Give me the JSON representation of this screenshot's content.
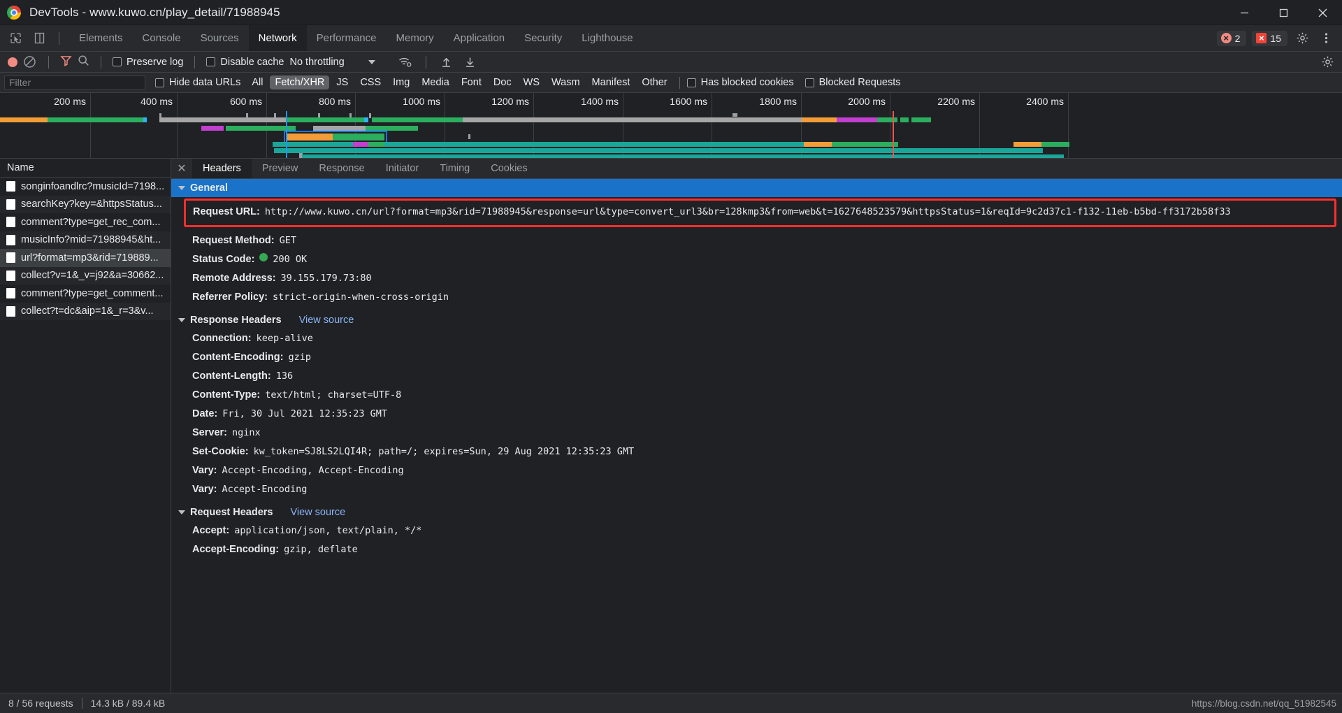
{
  "window": {
    "title": "DevTools - www.kuwo.cn/play_detail/71988945",
    "logo_icon": "chrome-logo",
    "minimize_icon": "minimize-icon",
    "maximize_icon": "maximize-icon",
    "close_icon": "close-icon"
  },
  "tabstrip": {
    "inspect_icon": "inspect-cursor-icon",
    "device_icon": "device-toolbar-icon",
    "tabs": [
      {
        "label": "Elements",
        "active": false
      },
      {
        "label": "Console",
        "active": false
      },
      {
        "label": "Sources",
        "active": false
      },
      {
        "label": "Network",
        "active": true
      },
      {
        "label": "Performance",
        "active": false
      },
      {
        "label": "Memory",
        "active": false
      },
      {
        "label": "Application",
        "active": false
      },
      {
        "label": "Security",
        "active": false
      },
      {
        "label": "Lighthouse",
        "active": false
      }
    ],
    "warning_count": "2",
    "error_count": "15",
    "settings_icon": "gear-icon",
    "more_icon": "more-vertical-icon"
  },
  "toolbar": {
    "record_icon": "record-stop-icon",
    "clear_icon": "clear-no-entry-icon",
    "filter_icon": "funnel-filter-icon",
    "search_icon": "search-magnifier-icon",
    "preserve_log_label": "Preserve log",
    "preserve_log_checked": false,
    "disable_cache_label": "Disable cache",
    "disable_cache_checked": false,
    "throttling_label": "No throttling",
    "throttling_caret_icon": "chevron-down-icon",
    "wifi_icon": "network-conditions-wifi-icon",
    "import_icon": "import-har-icon",
    "export_icon": "export-har-icon",
    "settings_icon": "gear-icon"
  },
  "filters": {
    "placeholder": "Filter",
    "value": "",
    "hide_data_urls_label": "Hide data URLs",
    "hide_data_urls_checked": false,
    "types": [
      {
        "label": "All",
        "active": false
      },
      {
        "label": "Fetch/XHR",
        "active": true
      },
      {
        "label": "JS",
        "active": false
      },
      {
        "label": "CSS",
        "active": false
      },
      {
        "label": "Img",
        "active": false
      },
      {
        "label": "Media",
        "active": false
      },
      {
        "label": "Font",
        "active": false
      },
      {
        "label": "Doc",
        "active": false
      },
      {
        "label": "WS",
        "active": false
      },
      {
        "label": "Wasm",
        "active": false
      },
      {
        "label": "Manifest",
        "active": false
      },
      {
        "label": "Other",
        "active": false
      }
    ],
    "has_blocked_cookies_label": "Has blocked cookies",
    "has_blocked_cookies_checked": false,
    "blocked_requests_label": "Blocked Requests",
    "blocked_requests_checked": false
  },
  "overview": {
    "ticks": [
      "200 ms",
      "400 ms",
      "600 ms",
      "800 ms",
      "1000 ms",
      "1200 ms",
      "1400 ms",
      "1600 ms",
      "1800 ms",
      "2000 ms",
      "2200 ms",
      "2400 ms"
    ],
    "colors": {
      "green": "#2bae5e",
      "teal": "#1aa79a",
      "orange": "#f29d38",
      "magenta": "#c23fd0",
      "gray": "#a6a6a6",
      "blue_marker": "#2196f3",
      "red_marker": "#ef5350"
    }
  },
  "request_list": {
    "header": "Name",
    "rows": [
      {
        "name": "songinfoandlrc?musicId=7198...",
        "selected": false
      },
      {
        "name": "searchKey?key=&httpsStatus...",
        "selected": false
      },
      {
        "name": "comment?type=get_rec_com...",
        "selected": false
      },
      {
        "name": "musicInfo?mid=71988945&ht...",
        "selected": false
      },
      {
        "name": "url?format=mp3&rid=719889...",
        "selected": true
      },
      {
        "name": "collect?v=1&_v=j92&a=30662...",
        "selected": false
      },
      {
        "name": "comment?type=get_comment...",
        "selected": false
      },
      {
        "name": "collect?t=dc&aip=1&_r=3&v...",
        "selected": false
      }
    ]
  },
  "details": {
    "close_icon": "close-icon",
    "tabs": [
      {
        "label": "Headers",
        "active": true
      },
      {
        "label": "Preview",
        "active": false
      },
      {
        "label": "Response",
        "active": false
      },
      {
        "label": "Initiator",
        "active": false
      },
      {
        "label": "Timing",
        "active": false
      },
      {
        "label": "Cookies",
        "active": false
      }
    ],
    "general": {
      "title": "General",
      "request_url_key": "Request URL:",
      "request_url_value": "http://www.kuwo.cn/url?format=mp3&rid=71988945&response=url&type=convert_url3&br=128kmp3&from=web&t=1627648523579&httpsStatus=1&reqId=9c2d37c1-f132-11eb-b5bd-ff3172b58f33",
      "request_method_key": "Request Method:",
      "request_method_value": "GET",
      "status_code_key": "Status Code:",
      "status_code_value": "200  OK",
      "remote_address_key": "Remote Address:",
      "remote_address_value": "39.155.179.73:80",
      "referrer_policy_key": "Referrer Policy:",
      "referrer_policy_value": "strict-origin-when-cross-origin"
    },
    "response_headers": {
      "title": "Response Headers",
      "view_source": "View source",
      "items": [
        {
          "key": "Connection:",
          "value": "keep-alive"
        },
        {
          "key": "Content-Encoding:",
          "value": "gzip"
        },
        {
          "key": "Content-Length:",
          "value": "136"
        },
        {
          "key": "Content-Type:",
          "value": "text/html; charset=UTF-8"
        },
        {
          "key": "Date:",
          "value": "Fri, 30 Jul 2021 12:35:23 GMT"
        },
        {
          "key": "Server:",
          "value": "nginx"
        },
        {
          "key": "Set-Cookie:",
          "value": "kw_token=SJ8LS2LQI4R; path=/; expires=Sun, 29 Aug 2021 12:35:23 GMT"
        },
        {
          "key": "Vary:",
          "value": "Accept-Encoding, Accept-Encoding"
        },
        {
          "key": "Vary:",
          "value": "Accept-Encoding"
        }
      ]
    },
    "request_headers": {
      "title": "Request Headers",
      "view_source": "View source",
      "items": [
        {
          "key": "Accept:",
          "value": "application/json, text/plain, */*"
        },
        {
          "key": "Accept-Encoding:",
          "value": "gzip, deflate"
        }
      ]
    }
  },
  "statusbar": {
    "requests": "8 / 56 requests",
    "transferred": "14.3 kB / 89.4 kB",
    "watermark": "https://blog.csdn.net/qq_51982545"
  }
}
